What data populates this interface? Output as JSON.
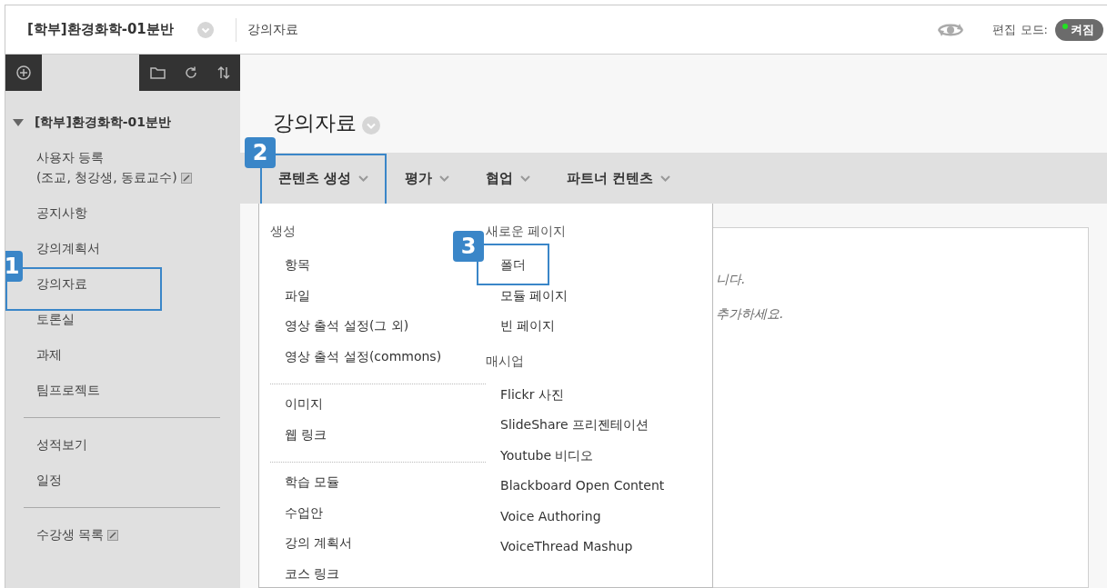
{
  "header": {
    "course": "[학부]환경화학-01분반",
    "page": "강의자료",
    "edit_mode_label": "편집 모드:",
    "edit_mode": {
      "label": "켜짐",
      "on": true
    }
  },
  "sidebar": {
    "course_title": "[학부]환경화학-01분반",
    "expanded": true,
    "groups": [
      [
        {
          "label": "사용자 등록\n(조교, 청강생, 동료교수)",
          "external": true
        },
        {
          "label": "공지사항",
          "external": false
        },
        {
          "label": "강의계획서",
          "external": false
        },
        {
          "label": "강의자료",
          "external": false,
          "callout": "1"
        },
        {
          "label": "토론실",
          "external": false
        },
        {
          "label": "과제",
          "external": false
        },
        {
          "label": "팀프로젝트",
          "external": false
        }
      ],
      [
        {
          "label": "성적보기",
          "external": false
        },
        {
          "label": "일정",
          "external": false
        }
      ],
      [
        {
          "label": "수강생 목록",
          "external": true
        }
      ]
    ]
  },
  "page_title": "강의자료",
  "action_bar": [
    {
      "label": "콘텐츠 생성",
      "callout": "2"
    },
    {
      "label": "평가"
    },
    {
      "label": "협업"
    },
    {
      "label": "파트너 컨텐츠"
    }
  ],
  "menu": {
    "columns": [
      [
        {
          "heading": "생성",
          "items": [
            {
              "label": "항목"
            },
            {
              "label": "파일"
            },
            {
              "label": "영상 출석 설정(그 외)"
            },
            {
              "label": "영상 출석 설정(commons)"
            }
          ]
        },
        {
          "items": [
            {
              "label": "이미지"
            },
            {
              "label": "웹 링크"
            }
          ]
        },
        {
          "items": [
            {
              "label": "학습 모듈"
            },
            {
              "label": "수업안"
            },
            {
              "label": "강의 계획서"
            },
            {
              "label": "코스 링크"
            }
          ]
        }
      ],
      [
        {
          "heading": "새로운 페이지",
          "items": [
            {
              "label": "폴더",
              "callout": "3"
            },
            {
              "label": "모듈 페이지"
            },
            {
              "label": "빈 페이지"
            }
          ]
        },
        {
          "heading": "매시업",
          "items": [
            {
              "label": "Flickr 사진"
            },
            {
              "label": "SlideShare 프리젠테이션"
            },
            {
              "label": "Youtube 비디오"
            },
            {
              "label": "Blackboard Open Content"
            },
            {
              "label": "Voice Authoring"
            },
            {
              "label": "VoiceThread Mashup"
            }
          ]
        }
      ]
    ]
  },
  "empty_message": [
    "니다.",
    "추가하세요."
  ]
}
